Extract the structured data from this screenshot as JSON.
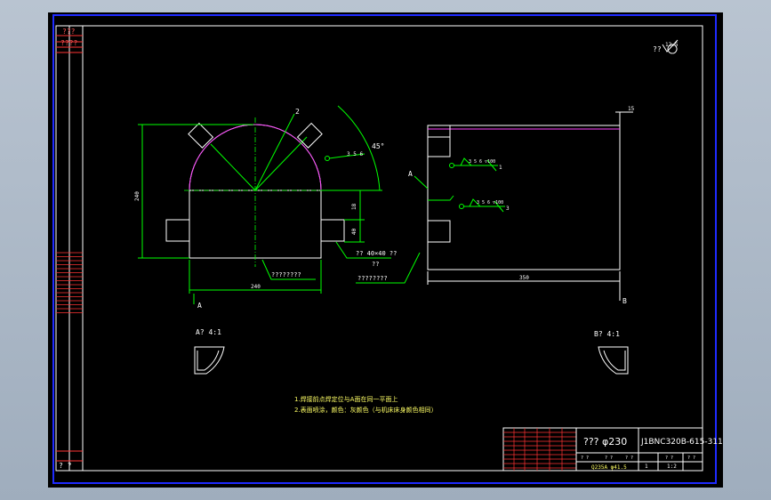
{
  "sheet": {
    "border_color": "#0000cc",
    "background": "#000000"
  },
  "left_strip": {
    "top_label_1": "???",
    "top_label_2": "????",
    "bottom_label": "? ?"
  },
  "top_right_note": {
    "prefix": "??",
    "roughness": "12.5"
  },
  "front_view": {
    "point_label": "2",
    "angle_label": "45°",
    "weld_symbol": "3 5 6",
    "dim_height": "240",
    "dim_18": "18",
    "dim_40": "40",
    "dim_width": "240",
    "callout_1": "?? 40×40 ??",
    "callout_1b": "??",
    "callout_2": "????????",
    "callout_3": "????????",
    "section_a": "A"
  },
  "side_view": {
    "label_a": "A",
    "dim_top": "15",
    "weld_1": "3 5 6 ▽100",
    "weld_1_num": "1",
    "weld_2": "3 5 6 ▽100",
    "weld_2_num": "3",
    "dim_length": "350",
    "label_b": "B"
  },
  "views": {
    "view_a": "A? 4:1",
    "view_b": "B? 4:1"
  },
  "notes": {
    "line_1": "1.焊接前点焊定位与A面在同一平面上",
    "line_2": "2.表面喷涂，颜色：灰颜色（与机床床身颜色相同）"
  },
  "title_block": {
    "part_name": "??? φ230",
    "drawing_no": "J1BNC320B-615-311",
    "material": "Q235A φ41.5",
    "scale_1": "1",
    "scale_2": "1:2",
    "cell_a": "? ?",
    "cell_b": "? ?",
    "cell_c": "? ?",
    "cell_d": "? ?",
    "cell_e": "? ?"
  }
}
